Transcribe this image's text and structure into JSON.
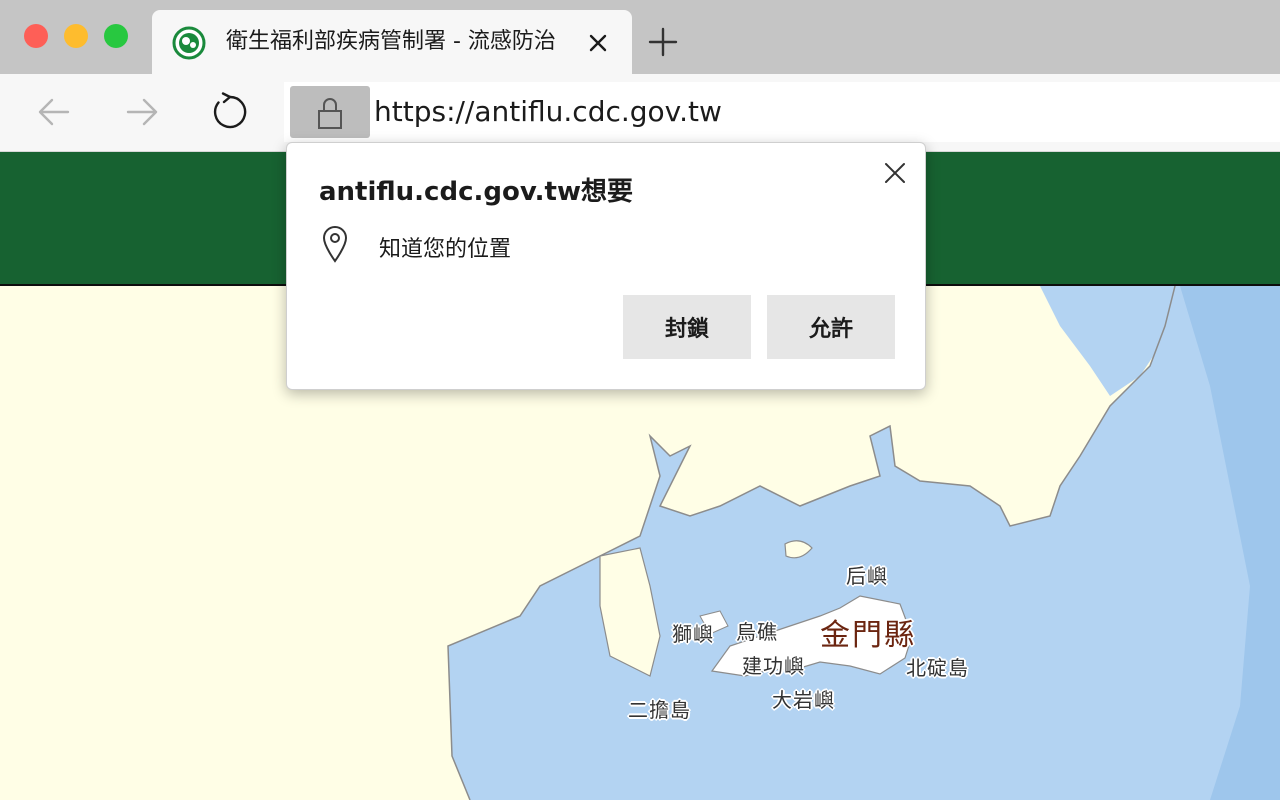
{
  "browser": {
    "tab": {
      "title": "衛生福利部疾病管制署 - 流感防治",
      "favicon": "cdc-logo-icon",
      "close_icon": "close-icon"
    },
    "new_tab_icon": "plus-icon",
    "nav": {
      "back_icon": "arrow-left-icon",
      "forward_icon": "arrow-right-icon",
      "reload_icon": "reload-icon"
    },
    "address": {
      "lock_icon": "lock-icon",
      "url": "https://antiflu.cdc.gov.tw"
    }
  },
  "permission_prompt": {
    "title": "antiflu.cdc.gov.tw想要",
    "permission_icon": "location-pin-icon",
    "permission_text": "知道您的位置",
    "block_label": "封鎖",
    "allow_label": "允許",
    "close_icon": "close-icon"
  },
  "page": {
    "header_color": "#176231",
    "map": {
      "labels": {
        "county": "金門縣",
        "houyu": "后嶼",
        "shiyu": "獅嶼",
        "wuqiu": "烏礁",
        "jiangong": "建功嶼",
        "beiding": "北碇島",
        "dadan": "大岩嶼",
        "erdan": "二擔島"
      },
      "colors": {
        "land": "#fffee6",
        "sea": "#b3d3f2",
        "deep_sea": "#9ec6ec",
        "island": "#ffffff"
      }
    }
  }
}
